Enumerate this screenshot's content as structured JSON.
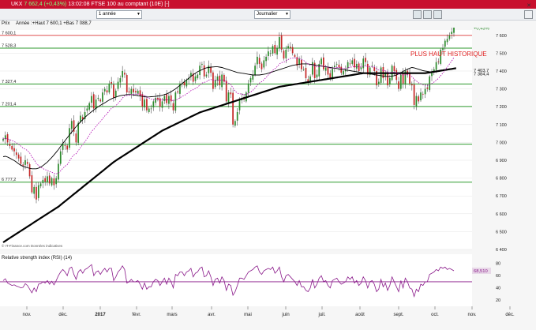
{
  "window": {
    "title_prefix": "UKX",
    "title_change": "7 662,4 (+0,43%)",
    "title_rest": "13:02:08 FTSE 100 au comptant (10E) [-]"
  },
  "toolbar": {
    "period_select": "1 année",
    "interval_select": "Journalier"
  },
  "info": {
    "price_label": "Prix",
    "year_stats": "Année :+Haut 7 600,1 +Bas 7 088,7"
  },
  "annotation": "PLUS HAUT HISTORIQUE",
  "source_note": "© IT-Finance.com Données indicatives",
  "rsi_title": "Relative strength index (RSI) (14)",
  "colors": {
    "up": "#2e8b2e",
    "down": "#c62828",
    "level": "#2e9a2e",
    "sma": "#000000",
    "ema": "#b000b0",
    "rsi": "#8a1a8a",
    "title_bg": "#c8102e",
    "annotation": "#e02020"
  },
  "chart_data": [
    {
      "type": "candlestick",
      "title": "",
      "x_ticks": [
        "nov.",
        "déc.",
        "2017",
        "févr.",
        "mars",
        "avr.",
        "mai",
        "juin",
        "juil.",
        "août",
        "sept.",
        "oct.",
        "nov.",
        "déc."
      ],
      "y_ticks": [
        "7 600",
        "7 500",
        "7 400",
        "7 300",
        "7 200",
        "7 100",
        "7 000",
        "6 900",
        "6 800",
        "6 700",
        "6 600",
        "6 500",
        "6 400"
      ],
      "ylim": [
        6400,
        7630
      ],
      "levels": [
        {
          "label": "7 600,1",
          "value": 7600.1
        },
        {
          "label": "7 528,3",
          "value": 7528.3
        },
        {
          "label": "7 327,4",
          "value": 7327.4
        },
        {
          "label": "7 201,4",
          "value": 7201.4
        },
        {
          "label": "",
          "value": 6990
        },
        {
          "label": "6 777,2",
          "value": 6777.2
        }
      ],
      "price_labels": [
        {
          "text": "7 662,4",
          "value": 7662.4
        },
        {
          "text": "+0,43%",
          "value": 7640
        },
        {
          "text": "7 403,7",
          "value": 7403.7
        },
        {
          "text": "7 384,4",
          "value": 7384.4
        }
      ],
      "closes": [
        7020,
        7040,
        7000,
        6980,
        6960,
        6950,
        6930,
        6910,
        6880,
        6870,
        6900,
        6880,
        6810,
        6720,
        6750,
        6680,
        6760,
        6770,
        6790,
        6780,
        6810,
        6770,
        6800,
        6760,
        6800,
        6880,
        6950,
        6990,
        6980,
        6960,
        7080,
        7120,
        7060,
        7000,
        7110,
        7150,
        7130,
        7170,
        7190,
        7220,
        7260,
        7190,
        7240,
        7250,
        7230,
        7280,
        7300,
        7280,
        7330,
        7330,
        7250,
        7290,
        7340,
        7360,
        7400,
        7380,
        7280,
        7280,
        7300,
        7280,
        7280,
        7290,
        7260,
        7200,
        7240,
        7180,
        7190,
        7190,
        7230,
        7250,
        7240,
        7200,
        7230,
        7260,
        7220,
        7260,
        7230,
        7180,
        7280,
        7280,
        7330,
        7330,
        7320,
        7350,
        7360,
        7390,
        7340,
        7370,
        7380,
        7430,
        7440,
        7370,
        7380,
        7430,
        7390,
        7300,
        7350,
        7370,
        7320,
        7380,
        7340,
        7230,
        7280,
        7270,
        7100,
        7120,
        7170,
        7240,
        7250,
        7240,
        7280,
        7330,
        7360,
        7380,
        7430,
        7480,
        7440,
        7410,
        7460,
        7480,
        7510,
        7500,
        7540,
        7500,
        7530,
        7590,
        7520,
        7470,
        7520,
        7540,
        7530,
        7500,
        7480,
        7430,
        7470,
        7410,
        7410,
        7360,
        7340,
        7370,
        7450,
        7360,
        7380,
        7440,
        7470,
        7410,
        7420,
        7380,
        7360,
        7420,
        7430,
        7440,
        7420,
        7390,
        7400,
        7410,
        7450,
        7440,
        7460,
        7420,
        7440,
        7400,
        7420,
        7470,
        7450,
        7380,
        7420,
        7430,
        7400,
        7320,
        7340,
        7420,
        7360,
        7390,
        7320,
        7360,
        7430,
        7400,
        7350,
        7300,
        7380,
        7330,
        7400,
        7380,
        7330,
        7320,
        7210,
        7260,
        7230,
        7280,
        7270,
        7300,
        7300,
        7370,
        7390,
        7410,
        7450,
        7450,
        7520,
        7530,
        7570,
        7580,
        7600,
        7620,
        7662
      ],
      "sma_50": [
        6920,
        6922,
        6918,
        6912,
        6905,
        6898,
        6890,
        6880,
        6872,
        6866,
        6862,
        6858,
        6855,
        6852,
        6852,
        6852,
        6856,
        6862,
        6870,
        6880,
        6890,
        6903,
        6916,
        6930,
        6945,
        6960,
        6978,
        6994,
        7010,
        7026,
        7042,
        7058,
        7074,
        7088,
        7102,
        7115,
        7128,
        7140,
        7152,
        7162,
        7172,
        7182,
        7192,
        7200,
        7208,
        7216,
        7222,
        7230,
        7238,
        7244,
        7250,
        7254,
        7258,
        7262,
        7264,
        7266,
        7268,
        7268,
        7268,
        7266,
        7264,
        7262,
        7260,
        7258,
        7256,
        7255,
        7255,
        7256,
        7257,
        7258,
        7260,
        7262,
        7264,
        7268,
        7272,
        7278,
        7284,
        7292,
        7300,
        7310,
        7320,
        7330,
        7340,
        7350,
        7360,
        7370,
        7380,
        7388,
        7396,
        7402,
        7408,
        7414,
        7418,
        7420,
        7422,
        7423,
        7424,
        7424,
        7422,
        7420,
        7416,
        7412,
        7408,
        7404,
        7400,
        7396,
        7392,
        7390,
        7388,
        7386,
        7384,
        7382,
        7380,
        7378,
        7378,
        7378,
        7378,
        7380,
        7382,
        7384,
        7388,
        7392,
        7396,
        7400,
        7404,
        7408,
        7412,
        7416,
        7420,
        7424,
        7428,
        7432,
        7434,
        7436,
        7438,
        7440,
        7440,
        7440,
        7440,
        7438,
        7436,
        7434,
        7432,
        7430,
        7428,
        7426,
        7424,
        7422,
        7420,
        7418,
        7416,
        7414,
        7412,
        7410,
        7408,
        7406,
        7404,
        7402,
        7400,
        7398,
        7396,
        7394,
        7392,
        7390,
        7388,
        7386,
        7384,
        7382,
        7380,
        7378,
        7376,
        7374,
        7372,
        7370,
        7370,
        7370,
        7372,
        7374,
        7378,
        7384,
        7390,
        7398,
        7404,
        7410,
        7416,
        7420,
        7418,
        7414,
        7410,
        7406,
        7402,
        7400,
        7398,
        7396,
        7394,
        7394,
        7396,
        7398,
        7400,
        7402,
        7404,
        7406,
        7408,
        7410
      ],
      "sma_200": [
        6440,
        6448,
        6456,
        6464,
        6472,
        6480,
        6488,
        6496,
        6504,
        6512,
        6520,
        6528,
        6536,
        6544,
        6552,
        6560,
        6568,
        6576,
        6584,
        6592,
        6600,
        6608,
        6616,
        6624,
        6632,
        6640,
        6650,
        6660,
        6670,
        6680,
        6690,
        6700,
        6710,
        6720,
        6730,
        6740,
        6750,
        6760,
        6770,
        6780,
        6790,
        6800,
        6810,
        6820,
        6830,
        6840,
        6850,
        6860,
        6870,
        6880,
        6890,
        6898,
        6906,
        6914,
        6922,
        6930,
        6938,
        6946,
        6954,
        6962,
        6970,
        6978,
        6986,
        6994,
        7002,
        7010,
        7018,
        7026,
        7034,
        7042,
        7050,
        7058,
        7066,
        7072,
        7078,
        7084,
        7090,
        7096,
        7102,
        7108,
        7114,
        7120,
        7126,
        7132,
        7138,
        7144,
        7150,
        7156,
        7162,
        7168,
        7172,
        7176,
        7180,
        7184,
        7188,
        7192,
        7196,
        7200,
        7204,
        7208,
        7212,
        7216,
        7220,
        7224,
        7228,
        7232,
        7236,
        7240,
        7244,
        7248,
        7252,
        7256,
        7260,
        7264,
        7268,
        7272,
        7276,
        7280,
        7284,
        7288,
        7292,
        7296,
        7300,
        7304,
        7308,
        7312,
        7314,
        7316,
        7318,
        7320,
        7322,
        7324,
        7326,
        7328,
        7330,
        7332,
        7334,
        7336,
        7338,
        7340,
        7342,
        7344,
        7346,
        7348,
        7350,
        7352,
        7354,
        7356,
        7358,
        7360,
        7362,
        7364,
        7366,
        7368,
        7370,
        7372,
        7374,
        7376,
        7378,
        7380,
        7382,
        7384,
        7386,
        7388,
        7388,
        7388,
        7388,
        7388,
        7388,
        7388,
        7388,
        7388,
        7388,
        7388,
        7388,
        7388,
        7388,
        7388,
        7388,
        7388,
        7388,
        7388,
        7388,
        7388,
        7388,
        7388,
        7388,
        7388,
        7388,
        7388,
        7388,
        7388,
        7390,
        7392,
        7394,
        7396,
        7398,
        7400,
        7402,
        7404,
        7406,
        7408,
        7410,
        7412,
        7414,
        7416
      ]
    },
    {
      "type": "line",
      "title": "Relative strength index (RSI) (14)",
      "series_name": "RSI",
      "y_ticks": [
        "80",
        "60",
        "40",
        "20"
      ],
      "ylim": [
        10,
        95
      ],
      "reference": 50,
      "last_label": "68,510",
      "values": [
        52,
        55,
        48,
        46,
        44,
        45,
        43,
        42,
        40,
        41,
        47,
        44,
        38,
        32,
        40,
        34,
        46,
        47,
        50,
        48,
        52,
        46,
        51,
        45,
        52,
        60,
        66,
        70,
        66,
        60,
        72,
        74,
        62,
        54,
        66,
        70,
        64,
        70,
        72,
        75,
        78,
        60,
        66,
        68,
        62,
        68,
        72,
        66,
        72,
        72,
        52,
        58,
        66,
        70,
        76,
        70,
        48,
        50,
        54,
        50,
        50,
        52,
        46,
        38,
        48,
        38,
        42,
        42,
        50,
        54,
        52,
        44,
        50,
        56,
        46,
        56,
        50,
        40,
        62,
        60,
        66,
        66,
        60,
        66,
        68,
        72,
        58,
        64,
        66,
        72,
        74,
        58,
        60,
        68,
        58,
        44,
        54,
        56,
        48,
        58,
        52,
        36,
        46,
        44,
        28,
        34,
        44,
        56,
        56,
        54,
        60,
        66,
        68,
        70,
        74,
        76,
        66,
        62,
        68,
        70,
        72,
        70,
        74,
        64,
        68,
        74,
        58,
        50,
        60,
        62,
        58,
        54,
        50,
        44,
        52,
        42,
        42,
        36,
        34,
        40,
        54,
        40,
        46,
        56,
        60,
        50,
        52,
        44,
        40,
        52,
        54,
        56,
        50,
        46,
        48,
        50,
        58,
        54,
        58,
        48,
        52,
        44,
        48,
        58,
        52,
        40,
        50,
        52,
        46,
        34,
        38,
        54,
        42,
        48,
        36,
        44,
        58,
        50,
        42,
        34,
        52,
        40,
        56,
        50,
        40,
        38,
        26,
        38,
        34,
        46,
        44,
        50,
        50,
        62,
        64,
        66,
        70,
        68,
        74,
        72,
        74,
        70,
        72,
        70,
        68
      ]
    }
  ]
}
